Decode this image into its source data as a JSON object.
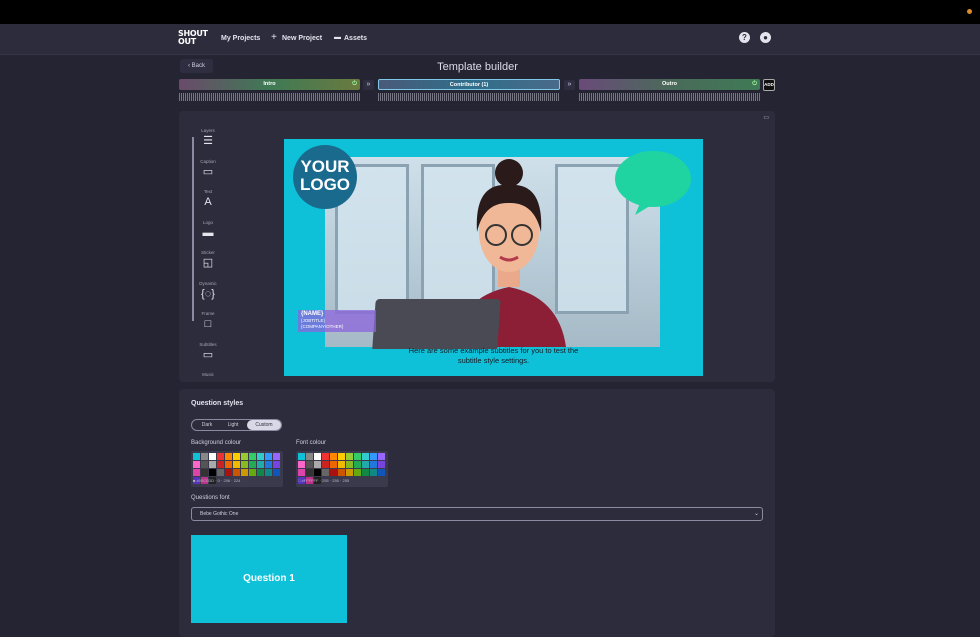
{
  "nav": {
    "logo_text": "SHOUT OUT",
    "my_projects": "My Projects",
    "new_project": "New Project",
    "assets": "Assets"
  },
  "page": {
    "back": "Back",
    "title": "Template builder"
  },
  "timeline": {
    "tracks": [
      {
        "label": "Intro",
        "color": "#3f7a55"
      },
      {
        "label": "Contributor (1)",
        "color": "#2f6f8a"
      },
      {
        "label": "Outro",
        "color": "#6a4a7a"
      }
    ],
    "add_label": "ADD"
  },
  "tools": [
    {
      "label": "Layers",
      "icon": "layers-icon",
      "glyph": "☰"
    },
    {
      "label": "Caption",
      "icon": "caption-icon",
      "glyph": "▭"
    },
    {
      "label": "Text",
      "icon": "text-icon",
      "glyph": "A"
    },
    {
      "label": "Logo",
      "icon": "logo-icon",
      "glyph": "▬"
    },
    {
      "label": "Sticker",
      "icon": "sticker-icon",
      "glyph": "◱"
    },
    {
      "label": "Dynamic",
      "icon": "dynamic-icon",
      "glyph": "{◌}"
    },
    {
      "label": "Frame",
      "icon": "frame-icon",
      "glyph": "□"
    },
    {
      "label": "Subtitles",
      "icon": "subtitles-icon",
      "glyph": "▭"
    },
    {
      "label": "Music",
      "icon": "music-icon",
      "glyph": ""
    }
  ],
  "preview": {
    "logo_line1": "YOUR",
    "logo_line2": "LOGO",
    "name_tag": "{NAME}",
    "name_sub1": "{JOBTITLE}",
    "name_sub2": "{COMPANY/OTHER}",
    "subtitle_line1": "Here are some example subtitles for you to test the",
    "subtitle_line2": "subtitle style settings."
  },
  "question_styles": {
    "heading": "Question styles",
    "modes": [
      "Dark",
      "Light",
      "Custom"
    ],
    "active_mode": "Custom",
    "background_label": "Background colour",
    "font_label": "Font colour",
    "background_values": [
      "#00C0DD",
      "0",
      "206",
      "224"
    ],
    "font_values": [
      "#FFFFFF",
      "255",
      "255",
      "255"
    ],
    "font_label_questions": "Questions font",
    "font_selected": "Bebe Gothic One",
    "preview_text": "Question 1",
    "accent_color": "#0fc1d8"
  }
}
